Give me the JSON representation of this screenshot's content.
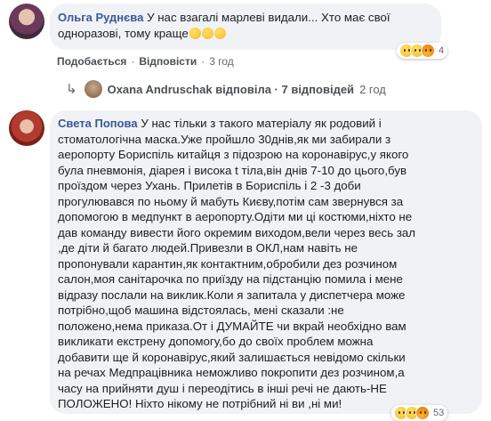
{
  "comment1": {
    "author": "Ольга Руднєва",
    "text": "У нас взагалі марлеві видали... Хто має свої одноразові, тому краще",
    "like": "Подобається",
    "reply": "Відповісти",
    "time": "3 год",
    "reaction_count": "4"
  },
  "replies": {
    "text": "Oxana Andruschak відповіла · 7 відповідей",
    "time": "2 год"
  },
  "comment2": {
    "author": "Света Попова",
    "lines": [
      "У нас тільки з такого матеріалу як родовий і",
      "стоматологічна маска.Уже пройшло 30днів,як ми забирали з",
      "аеропорту Бориспіль китайця з підозрою на коронавірус,у якого",
      "була пневмонія, діарея і висока t тіла,він днів 7-10 до цього,був",
      "проїздом через Ухань. Прилетів в Бориспіль і 2 -3 доби",
      "прогулювався по ньому й мабуть Києву,потім сам звернувся за",
      "допомогою в медпункт в аеропорту.Одіти ми ці костюми,ніхто не",
      "дав команду вивести його окремим виходом,вели через весь зал",
      ",де діти й багато людей.Привезли в ОКЛ,нам навіть не",
      "пропонували карантин,як контактним,обробили дез розчином",
      "салон,моя санітарочка по приїзду на підстанцію помила і мене",
      "відразу послали на виклик.Коли я запитала у диспетчера може",
      "потрібно,щоб машина відстоялась, мені сказали :не",
      "положено,нема приказа.От і ДУМАЙТЕ чи вкрай необхідно вам",
      "викликати екстрену допомогу,бо до своїх проблем можна",
      "добавити ще й коронавірус,який залишається невідомо скільки",
      "на речах Медпрацівника неможливо покропити дез розчином,а",
      "часу на прийняти душ і переодітись в інші речі не дають-НЕ",
      "ПОЛОЖЕНО! Ніхто нікому не потрібний ні ви ,ні ми!"
    ],
    "reaction_count": "53"
  }
}
